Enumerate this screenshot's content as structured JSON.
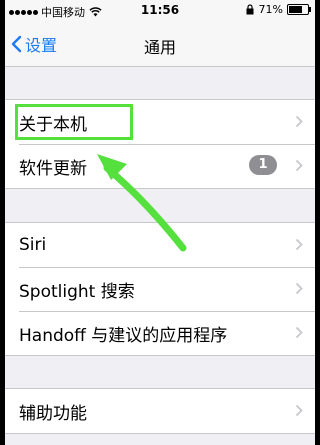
{
  "status_bar": {
    "carrier": "中国移动",
    "time": "11:56",
    "battery_percent": "71%",
    "battery_level": 0.71
  },
  "nav": {
    "back_label": "设置",
    "title": "通用"
  },
  "groups": [
    {
      "items": [
        {
          "label": "关于本机"
        },
        {
          "label": "软件更新",
          "badge": "1"
        }
      ]
    },
    {
      "items": [
        {
          "label": "Siri"
        },
        {
          "label": "Spotlight 搜索"
        },
        {
          "label": "Handoff 与建议的应用程序"
        }
      ]
    },
    {
      "items": [
        {
          "label": "辅助功能"
        }
      ]
    }
  ],
  "annotation": {
    "color": "#55e03e",
    "target": "关于本机"
  }
}
